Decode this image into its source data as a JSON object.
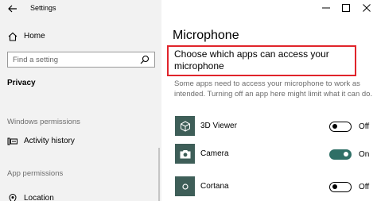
{
  "window": {
    "title": "Settings"
  },
  "sidebar": {
    "home_label": "Home",
    "search_placeholder": "Find a setting",
    "category": "Privacy",
    "sections": [
      {
        "header": "Windows permissions",
        "items": [
          {
            "label": "Activity history",
            "icon": "activity-history-icon"
          }
        ]
      },
      {
        "header": "App permissions",
        "items": [
          {
            "label": "Location",
            "icon": "location-icon"
          }
        ]
      }
    ]
  },
  "main": {
    "page_title": "Microphone",
    "section_title": "Choose which apps can access your microphone",
    "description": "Some apps need to access your microphone to work as intended. Turning off an app here might limit what it can do.",
    "apps": [
      {
        "name": "3D Viewer",
        "state": "Off",
        "enabled": false,
        "icon": "cube-icon"
      },
      {
        "name": "Camera",
        "state": "On",
        "enabled": true,
        "icon": "camera-icon"
      },
      {
        "name": "Cortana",
        "state": "Off",
        "enabled": false,
        "icon": "cortana-icon"
      }
    ]
  },
  "colors": {
    "accent": "#2f6f66",
    "tile": "#3e5e58",
    "highlight": "#e0242b",
    "sidebar_bg": "#f2f2f2"
  }
}
